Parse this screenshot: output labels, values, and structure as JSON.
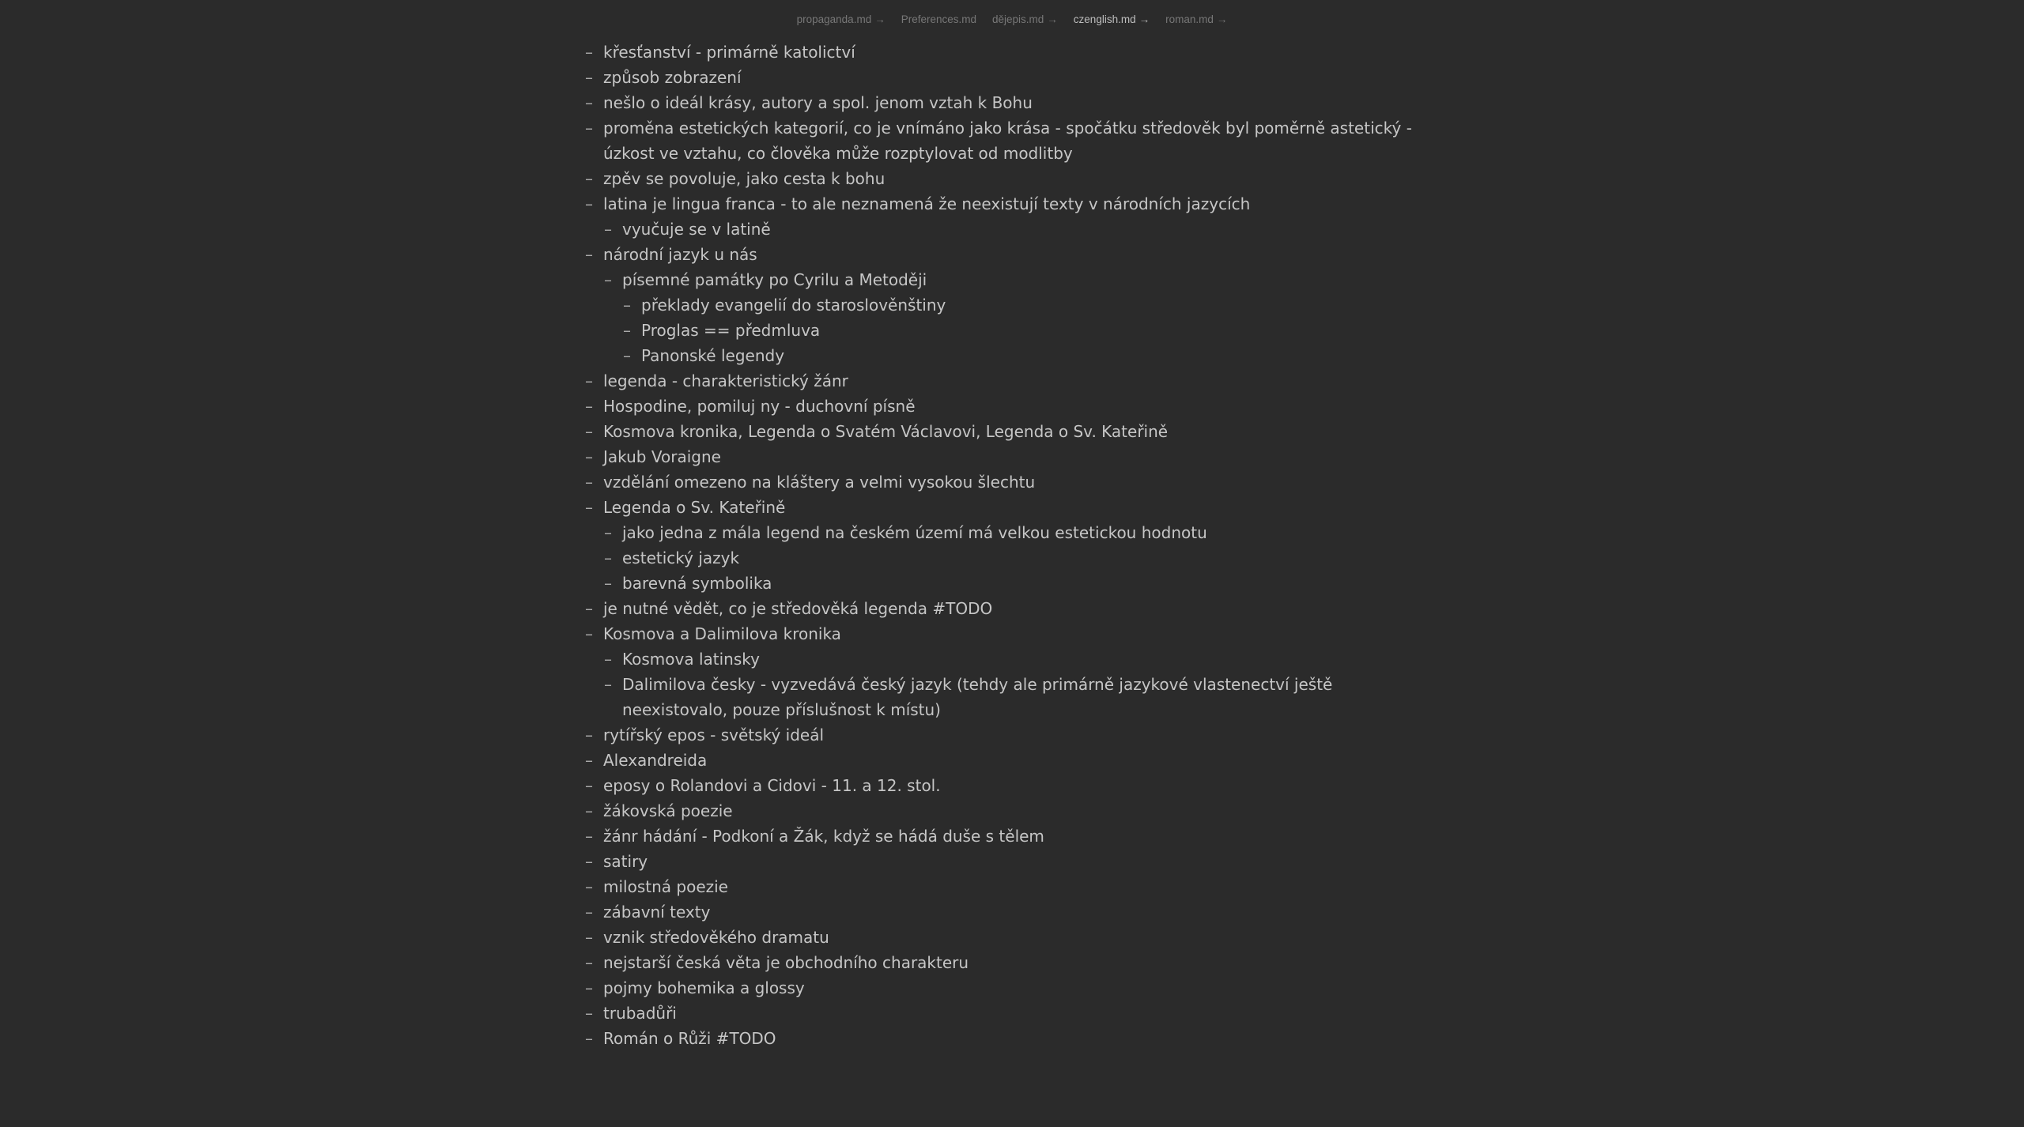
{
  "tabs": [
    {
      "label": "propaganda.md",
      "arrow": "→",
      "active": false
    },
    {
      "label": "Preferences.md",
      "arrow": "",
      "active": false
    },
    {
      "label": "dějepis.md",
      "arrow": "→",
      "active": false
    },
    {
      "label": "czenglish.md",
      "arrow": "→",
      "active": true
    },
    {
      "label": "roman.md",
      "arrow": "→",
      "active": false
    }
  ],
  "bullet_marker": "–",
  "notes": [
    {
      "level": 0,
      "text": "křesťanství - primárně katolictví"
    },
    {
      "level": 0,
      "text": "způsob zobrazení"
    },
    {
      "level": 0,
      "text": "nešlo o ideál krásy, autory a spol. jenom vztah k Bohu"
    },
    {
      "level": 0,
      "text": "proměna estetických kategorií, co je vnímáno jako krása - spočátku středověk byl poměrně astetický - úzkost ve vztahu, co člověka může rozptylovat od modlitby"
    },
    {
      "level": 0,
      "text": "zpěv se povoluje, jako cesta k bohu"
    },
    {
      "level": 0,
      "text": "latina je lingua franca - to ale neznamená že neexistují texty v národních jazycích"
    },
    {
      "level": 1,
      "text": "vyučuje se v latině"
    },
    {
      "level": 0,
      "text": "národní jazyk u nás"
    },
    {
      "level": 1,
      "text": "písemné památky po Cyrilu a Metoději"
    },
    {
      "level": 2,
      "text": "překlady evangelií do staroslověnštiny"
    },
    {
      "level": 2,
      "text": "Proglas == předmluva"
    },
    {
      "level": 2,
      "text": "Panonské legendy"
    },
    {
      "level": 0,
      "text": "legenda - charakteristický žánr"
    },
    {
      "level": 0,
      "text": "Hospodine, pomiluj ny - duchovní písně"
    },
    {
      "level": 0,
      "text": "Kosmova kronika, Legenda o Svatém Václavovi, Legenda o Sv. Kateřině"
    },
    {
      "level": 0,
      "text": "Jakub Voraigne"
    },
    {
      "level": 0,
      "text": "vzdělání omezeno na kláštery a velmi vysokou šlechtu"
    },
    {
      "level": 0,
      "text": "Legenda o Sv. Kateřině"
    },
    {
      "level": 1,
      "text": "jako jedna z mála legend na českém území má velkou estetickou hodnotu"
    },
    {
      "level": 1,
      "text": "estetický jazyk"
    },
    {
      "level": 1,
      "text": "barevná symbolika"
    },
    {
      "level": 0,
      "text": "je nutné vědět, co je středověká legenda #TODO"
    },
    {
      "level": 0,
      "text": "Kosmova a Dalimilova kronika"
    },
    {
      "level": 1,
      "text": "Kosmova latinsky"
    },
    {
      "level": 1,
      "text": "Dalimilova česky - vyzvedává český jazyk (tehdy ale primárně jazykové vlastenectví ještě neexistovalo, pouze příslušnost k místu)"
    },
    {
      "level": 0,
      "text": "rytířský epos - světský ideál"
    },
    {
      "level": 0,
      "text": "Alexandreida"
    },
    {
      "level": 0,
      "text": "eposy o Rolandovi a Cidovi - 11. a 12. stol."
    },
    {
      "level": 0,
      "text": "žákovská poezie"
    },
    {
      "level": 0,
      "text": "žánr hádání - Podkoní a Žák, když se hádá duše s tělem"
    },
    {
      "level": 0,
      "text": "satiry"
    },
    {
      "level": 0,
      "text": "milostná poezie"
    },
    {
      "level": 0,
      "text": "zábavní texty"
    },
    {
      "level": 0,
      "text": "vznik středověkého dramatu"
    },
    {
      "level": 0,
      "text": "nejstarší česká věta je obchodního charakteru"
    },
    {
      "level": 0,
      "text": "pojmy bohemika a glossy"
    },
    {
      "level": 0,
      "text": "trubadůři"
    },
    {
      "level": 0,
      "text": "Román o Růži #TODO"
    }
  ]
}
